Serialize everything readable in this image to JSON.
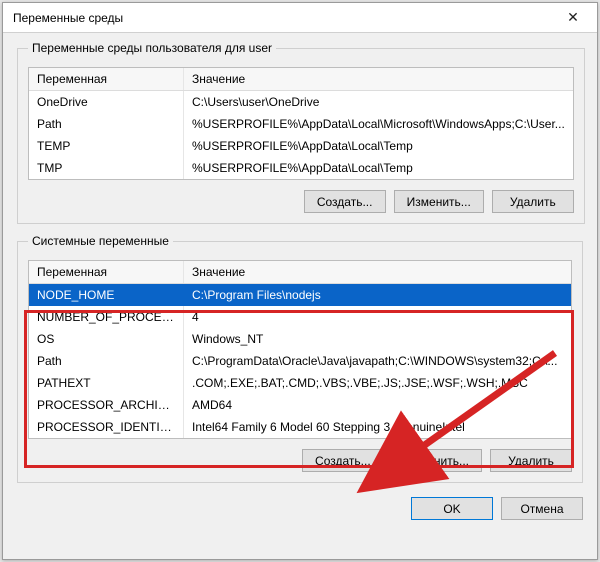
{
  "window": {
    "title": "Переменные среды",
    "close_icon": "✕"
  },
  "user_group": {
    "legend": "Переменные среды пользователя для user",
    "head_var": "Переменная",
    "head_val": "Значение",
    "rows": [
      {
        "var": "OneDrive",
        "val": "C:\\Users\\user\\OneDrive"
      },
      {
        "var": "Path",
        "val": "%USERPROFILE%\\AppData\\Local\\Microsoft\\WindowsApps;C:\\User..."
      },
      {
        "var": "TEMP",
        "val": "%USERPROFILE%\\AppData\\Local\\Temp"
      },
      {
        "var": "TMP",
        "val": "%USERPROFILE%\\AppData\\Local\\Temp"
      }
    ],
    "btn_new": "Создать...",
    "btn_edit": "Изменить...",
    "btn_delete": "Удалить"
  },
  "system_group": {
    "legend": "Системные переменные",
    "head_var": "Переменная",
    "head_val": "Значение",
    "rows": [
      {
        "var": "NODE_HOME",
        "val": "C:\\Program Files\\nodejs",
        "selected": true
      },
      {
        "var": "NUMBER_OF_PROCESSORS",
        "val": "4"
      },
      {
        "var": "OS",
        "val": "Windows_NT"
      },
      {
        "var": "Path",
        "val": "C:\\ProgramData\\Oracle\\Java\\javapath;C:\\WINDOWS\\system32;C:\\..."
      },
      {
        "var": "PATHEXT",
        "val": ".COM;.EXE;.BAT;.CMD;.VBS;.VBE;.JS;.JSE;.WSF;.WSH;.MSC"
      },
      {
        "var": "PROCESSOR_ARCHITECTURE",
        "val": "AMD64"
      },
      {
        "var": "PROCESSOR_IDENTIFIER",
        "val": "Intel64 Family 6 Model 60 Stepping 3, GenuineIntel"
      }
    ],
    "btn_new": "Создать...",
    "btn_edit": "Изменить...",
    "btn_delete": "Удалить"
  },
  "dialog": {
    "ok": "OK",
    "cancel": "Отмена"
  },
  "annotation": {
    "color": "#d62424"
  }
}
